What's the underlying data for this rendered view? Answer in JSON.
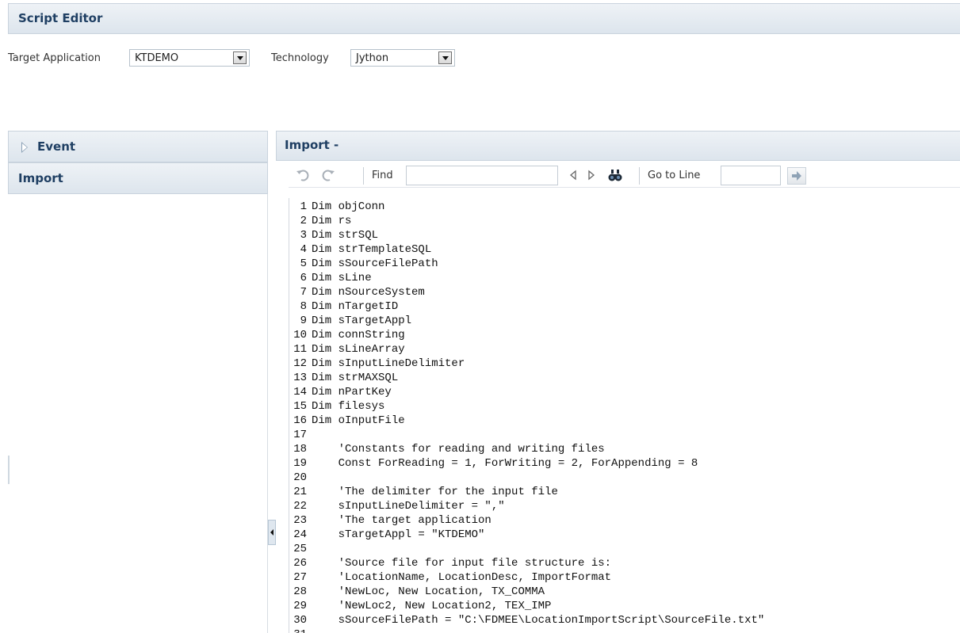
{
  "header": {
    "title": "Script Editor"
  },
  "controls": {
    "target_application_label": "Target Application",
    "target_application_value": "KTDEMO",
    "technology_label": "Technology",
    "technology_value": "Jython"
  },
  "left_panel": {
    "event_header": "Event",
    "import_header": "Import"
  },
  "editor": {
    "title": "Import -",
    "find_label": "Find",
    "find_value": "",
    "goto_label": "Go to Line",
    "goto_value": "",
    "lines": [
      "Dim objConn",
      "Dim rs",
      "Dim strSQL",
      "Dim strTemplateSQL",
      "Dim sSourceFilePath",
      "Dim sLine",
      "Dim nSourceSystem",
      "Dim nTargetID",
      "Dim sTargetAppl",
      "Dim connString",
      "Dim sLineArray",
      "Dim sInputLineDelimiter",
      "Dim strMAXSQL",
      "Dim nPartKey",
      "Dim filesys",
      "Dim oInputFile",
      "",
      "    'Constants for reading and writing files",
      "    Const ForReading = 1, ForWriting = 2, ForAppending = 8",
      "",
      "    'The delimiter for the input file",
      "    sInputLineDelimiter = \",\"",
      "    'The target application",
      "    sTargetAppl = \"KTDEMO\"",
      "",
      "    'Source file for input file structure is:",
      "    'LocationName, LocationDesc, ImportFormat",
      "    'NewLoc, New Location, TX_COMMA",
      "    'NewLoc2, New Location2, TEX_IMP",
      "    sSourceFilePath = \"C:\\FDMEE\\LocationImportScript\\SourceFile.txt\"",
      ""
    ]
  },
  "icons": {
    "undo": "undo-icon",
    "redo": "redo-icon",
    "find_prev": "triangle-left-icon",
    "find_next": "triangle-right-icon",
    "find_all": "binoculars-icon",
    "goto": "arrow-right-icon",
    "collapse": "collapse-left-icon"
  }
}
